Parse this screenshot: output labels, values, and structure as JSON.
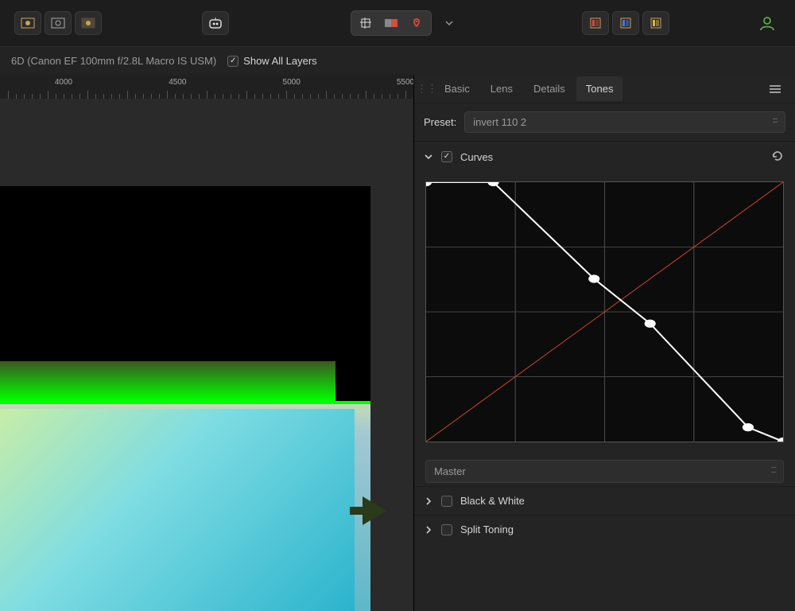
{
  "toolbar": {
    "group_view": [
      "histogram-1-icon",
      "histogram-2-icon",
      "histogram-3-icon"
    ],
    "ai_icon": "robot-icon",
    "center_group": [
      "crop-icon",
      "mask-icon",
      "heal-icon"
    ],
    "dropdown_icon": "chevron-down-icon",
    "right_group": [
      {
        "name": "palette-red-icon",
        "color": "#d94b3e"
      },
      {
        "name": "palette-blue-icon",
        "color": "#4a7ad6"
      },
      {
        "name": "palette-yellow-icon",
        "color": "#d8b84a"
      }
    ],
    "profile_icon": "user-icon"
  },
  "infobar": {
    "camera_text": "6D (Canon EF 100mm f/2.8L Macro IS USM)",
    "show_all_layers_label": "Show All Layers",
    "show_all_layers_checked": true
  },
  "ruler": {
    "ticks": [
      4000,
      4500,
      5000,
      5500
    ]
  },
  "panel": {
    "tabs": [
      "Basic",
      "Lens",
      "Details",
      "Tones"
    ],
    "active_tab": "Tones",
    "preset_label": "Preset:",
    "preset_value": "invert 110 2",
    "sections": {
      "curves": {
        "label": "Curves",
        "enabled": true,
        "expanded": true,
        "channel": "Master"
      },
      "bw": {
        "label": "Black & White",
        "enabled": false,
        "expanded": false
      },
      "split": {
        "label": "Split Toning",
        "enabled": false,
        "expanded": false
      }
    }
  },
  "chart_data": {
    "type": "line",
    "title": "Curves",
    "xlabel": "",
    "ylabel": "",
    "xlim": [
      0,
      255
    ],
    "ylim": [
      0,
      255
    ],
    "grid": {
      "x": 4,
      "y": 4
    },
    "series": [
      {
        "name": "identity",
        "color": "#cc4433",
        "values": [
          [
            0,
            0
          ],
          [
            255,
            255
          ]
        ]
      },
      {
        "name": "master-curve",
        "color": "#ffffff",
        "points": true,
        "values": [
          [
            0,
            255
          ],
          [
            48,
            255
          ],
          [
            120,
            160
          ],
          [
            160,
            116
          ],
          [
            230,
            14
          ],
          [
            255,
            0
          ]
        ]
      }
    ]
  }
}
